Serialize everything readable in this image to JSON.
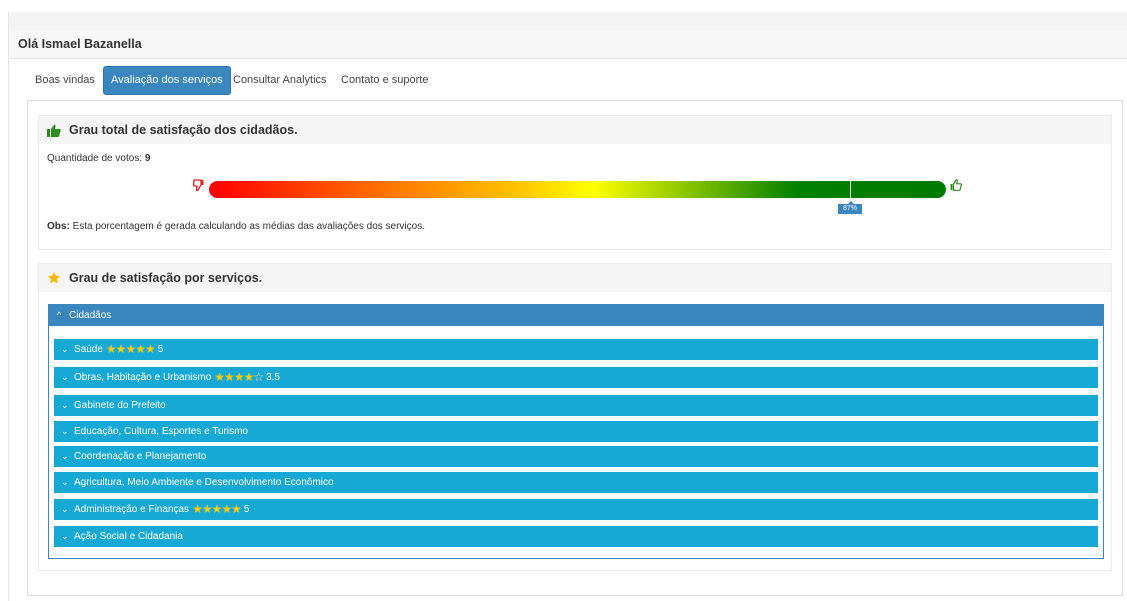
{
  "header": {
    "greeting": "Olá Ismael Bazanella"
  },
  "tabs": [
    {
      "label": "Boas vindas",
      "active": false
    },
    {
      "label": "Avaliação dos serviços",
      "active": true
    },
    {
      "label": "Consultar Analytics",
      "active": false
    },
    {
      "label": "Contato e suporte",
      "active": false
    }
  ],
  "satisfaction": {
    "title": "Grau total de satisfação dos cidadãos.",
    "votes_label": "Quantidade de votos:",
    "votes_value": "9",
    "gauge_percent": 0.87,
    "gauge_label": "87%",
    "obs_label": "Obs:",
    "obs_text": "Esta porcentagem é gerada calculando as médias das avaliações dos serviços."
  },
  "services": {
    "title": "Grau de satisfação por serviços.",
    "group": "Cidadãos",
    "items": [
      {
        "label": "Saúde",
        "stars": 5,
        "rating": "5"
      },
      {
        "label": "Obras, Habitação e Urbanismo",
        "stars": 3.5,
        "rating": "3.5"
      },
      {
        "label": "Gabinete do Prefeito",
        "stars": 0,
        "rating": ""
      },
      {
        "label": "Educação, Cultura, Esportes e Turismo",
        "stars": 0,
        "rating": ""
      },
      {
        "label": "Coordenação e Planejamento",
        "stars": 0,
        "rating": ""
      },
      {
        "label": "Agricultura, Meio Ambiente e Desenvolvimento Econômico",
        "stars": 0,
        "rating": ""
      },
      {
        "label": "Administração e Finanças",
        "stars": 5,
        "rating": "5"
      },
      {
        "label": "Ação Social e Cidadania",
        "stars": 0,
        "rating": ""
      }
    ]
  },
  "colors": {
    "primary": "#3a87c0",
    "item": "#17a9d6",
    "star": "#ffcc00",
    "good": "#008000",
    "bad": "#ff0000"
  },
  "icons": {
    "satisfaction": "thumbs-up-icon",
    "services": "star-icon",
    "bad": "thumbs-down-icon",
    "good": "thumbs-up-outline-icon"
  }
}
